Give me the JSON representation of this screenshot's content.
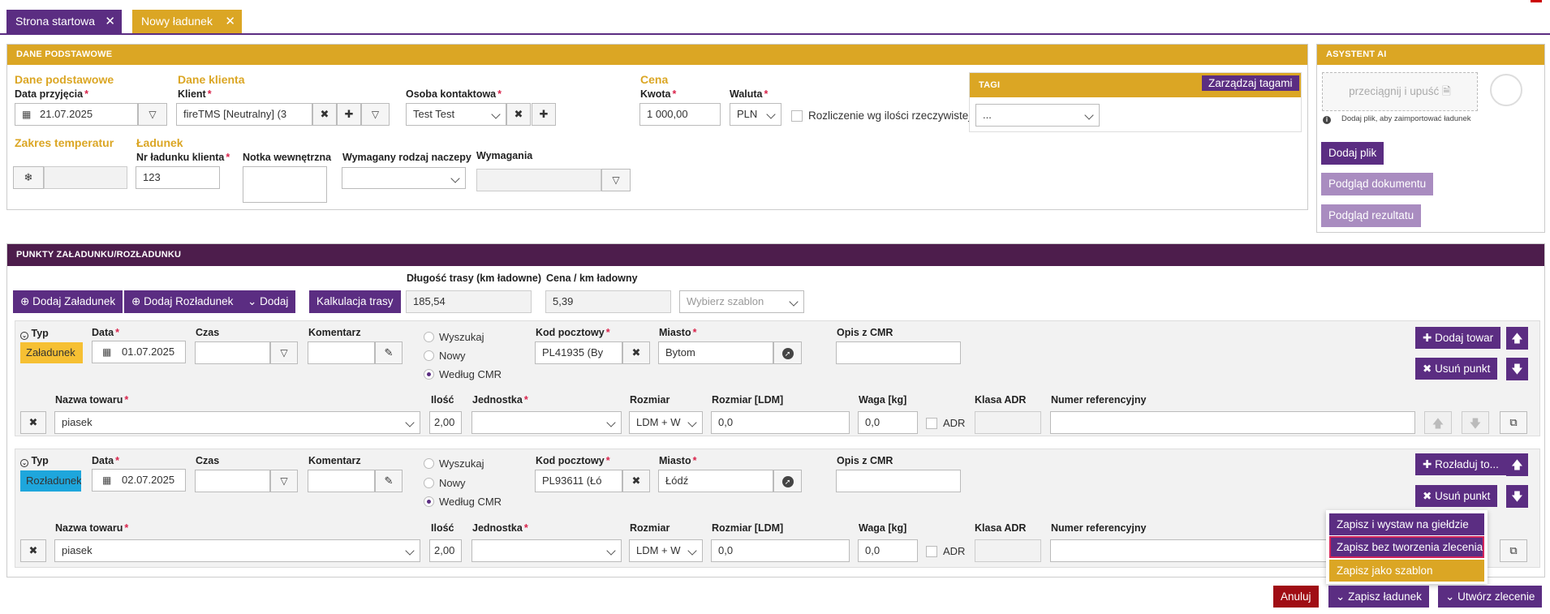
{
  "tabs": [
    {
      "label": "Strona startowa",
      "color": "#5b2d82"
    },
    {
      "label": "Nowy ładunek",
      "color": "#dba624"
    }
  ],
  "basic": {
    "header": "DANE PODSTAWOWE",
    "section_basic": "Dane podstawowe",
    "section_client": "Dane klienta",
    "section_price": "Cena",
    "section_temp": "Zakres temperatur",
    "section_cargo": "Ładunek",
    "date_label": "Data przyjęcia",
    "date_value": "21.07.2025",
    "client_label": "Klient",
    "client_value": "fireTMS [Neutralny] (3",
    "contact_label": "Osoba kontaktowa",
    "contact_value": "Test Test",
    "amount_label": "Kwota",
    "amount_value": "1 000,00",
    "currency_label": "Waluta",
    "currency_value": "PLN",
    "billing_label": "Rozliczenie wg ilości rzeczywistej",
    "client_order_label": "Nr ładunku klienta",
    "client_order_value": "123",
    "internal_note_label": "Notka wewnętrzna",
    "trailer_label": "Wymagany rodzaj naczepy",
    "requirements_label": "Wymagania",
    "tags_header": "TAGI",
    "tags_manage": "Zarządzaj tagami",
    "tags_value": "..."
  },
  "ai": {
    "header": "ASYSTENT AI",
    "drop_label": "przeciągnij i upuść",
    "hint": "Dodaj plik, aby zaimportować ładunek",
    "add_file": "Dodaj plik",
    "preview_doc": "Podgląd dokumentu",
    "preview_result": "Podgląd rezultatu"
  },
  "points": {
    "header": "PUNKTY ZAŁADUNKU/ROZŁADUNKU",
    "add_loading": "Dodaj Załadunek",
    "add_unloading": "Dodaj Rozładunek",
    "add": "Dodaj",
    "route_calc": "Kalkulacja trasy",
    "route_length_label": "Długość trasy (km ładowne)",
    "route_length_value": "185,54",
    "price_km_label": "Cena / km ładowny",
    "price_km_value": "5,39",
    "template_placeholder": "Wybierz szablon"
  },
  "labels": {
    "type": "Typ",
    "date": "Data",
    "time": "Czas",
    "comment": "Komentarz",
    "search": "Wyszukaj",
    "new": "Nowy",
    "by_cmr": "Według CMR",
    "postal": "Kod pocztowy",
    "city": "Miasto",
    "cmr_desc": "Opis z CMR",
    "goods_name": "Nazwa towaru",
    "qty": "Ilość",
    "unit": "Jednostka",
    "size": "Rozmiar",
    "size_ldm": "Rozmiar [LDM]",
    "weight": "Waga [kg]",
    "adr_class": "Klasa ADR",
    "ref_number": "Numer referencyjny",
    "adr": "ADR",
    "remove_point": "Usuń punkt"
  },
  "stops": [
    {
      "type": "Załadunek",
      "type_color": "#f6c033",
      "date": "01.07.2025",
      "postal": "PL41935 (By",
      "city": "Bytom",
      "goods_button": "Dodaj towar",
      "goods": {
        "name": "piasek",
        "qty": "2,00",
        "size": "LDM + W",
        "ldm": "0,0",
        "weight": "0,0"
      }
    },
    {
      "type": "Rozładunek",
      "type_color": "#1ea6dc",
      "date": "02.07.2025",
      "postal": "PL93611 (Łó",
      "city": "Łódź",
      "goods_button": "Rozładuj to...",
      "goods": {
        "name": "piasek",
        "qty": "2,00",
        "size": "LDM + W",
        "ldm": "0,0",
        "weight": "0,0"
      }
    }
  ],
  "save_menu": {
    "items": [
      {
        "label": "Zapisz i wystaw na giełdzie",
        "color": "#5b2d82"
      },
      {
        "label": "Zapisz bez tworzenia zlecenia",
        "color": "#5b2d82"
      },
      {
        "label": "Zapisz jako szablon",
        "color": "#dba624"
      }
    ]
  },
  "footer": {
    "cancel": "Anuluj",
    "save_load": "Zapisz ładunek",
    "create_order": "Utwórz zlecenie"
  }
}
